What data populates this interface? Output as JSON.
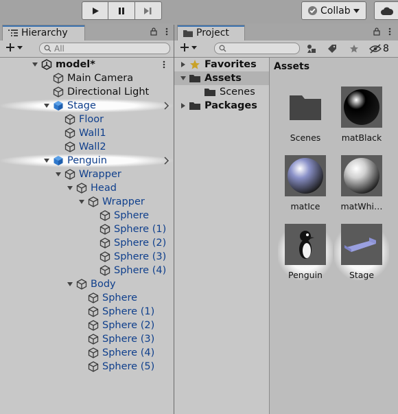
{
  "toolbar": {
    "collab_label": "Collab",
    "play_icon": "play-icon",
    "pause_icon": "pause-icon",
    "step_icon": "step-icon"
  },
  "hierarchy": {
    "tab_label": "Hierarchy",
    "search_placeholder": "All",
    "rows": [
      {
        "label": "model*",
        "depth": 0,
        "fold": "open",
        "icon": "unity-scene-icon",
        "blue": false,
        "bold": true,
        "menu": true
      },
      {
        "label": "Main Camera",
        "depth": 1,
        "fold": "",
        "icon": "gameobject-icon",
        "blue": false
      },
      {
        "label": "Directional Light",
        "depth": 1,
        "fold": "",
        "icon": "gameobject-icon",
        "blue": false
      },
      {
        "label": "Stage",
        "depth": 1,
        "fold": "open",
        "icon": "prefab-icon",
        "blue": true,
        "arrow": true,
        "highlight": true
      },
      {
        "label": "Floor",
        "depth": 2,
        "fold": "",
        "icon": "gameobject-icon",
        "blue": true
      },
      {
        "label": "Wall1",
        "depth": 2,
        "fold": "",
        "icon": "gameobject-icon",
        "blue": true
      },
      {
        "label": "Wall2",
        "depth": 2,
        "fold": "",
        "icon": "gameobject-icon",
        "blue": true
      },
      {
        "label": "Penguin",
        "depth": 1,
        "fold": "open",
        "icon": "prefab-icon",
        "blue": true,
        "arrow": true,
        "highlight": true
      },
      {
        "label": "Wrapper",
        "depth": 2,
        "fold": "open",
        "icon": "gameobject-icon",
        "blue": true
      },
      {
        "label": "Head",
        "depth": 3,
        "fold": "open",
        "icon": "gameobject-icon",
        "blue": true
      },
      {
        "label": "Wrapper",
        "depth": 4,
        "fold": "open",
        "icon": "gameobject-icon",
        "blue": true
      },
      {
        "label": "Sphere",
        "depth": 5,
        "fold": "",
        "icon": "gameobject-icon",
        "blue": true
      },
      {
        "label": "Sphere (1)",
        "depth": 5,
        "fold": "",
        "icon": "gameobject-icon",
        "blue": true
      },
      {
        "label": "Sphere (2)",
        "depth": 5,
        "fold": "",
        "icon": "gameobject-icon",
        "blue": true
      },
      {
        "label": "Sphere (3)",
        "depth": 5,
        "fold": "",
        "icon": "gameobject-icon",
        "blue": true
      },
      {
        "label": "Sphere (4)",
        "depth": 5,
        "fold": "",
        "icon": "gameobject-icon",
        "blue": true
      },
      {
        "label": "Body",
        "depth": 3,
        "fold": "open",
        "icon": "gameobject-icon",
        "blue": true
      },
      {
        "label": "Sphere",
        "depth": 4,
        "fold": "",
        "icon": "gameobject-icon",
        "blue": true
      },
      {
        "label": "Sphere (1)",
        "depth": 4,
        "fold": "",
        "icon": "gameobject-icon",
        "blue": true
      },
      {
        "label": "Sphere (2)",
        "depth": 4,
        "fold": "",
        "icon": "gameobject-icon",
        "blue": true
      },
      {
        "label": "Sphere (3)",
        "depth": 4,
        "fold": "",
        "icon": "gameobject-icon",
        "blue": true
      },
      {
        "label": "Sphere (4)",
        "depth": 4,
        "fold": "",
        "icon": "gameobject-icon",
        "blue": true
      },
      {
        "label": "Sphere (5)",
        "depth": 4,
        "fold": "",
        "icon": "gameobject-icon",
        "blue": true
      }
    ]
  },
  "project": {
    "tab_label": "Project",
    "hidden_count": "8",
    "tree": [
      {
        "label": "Favorites",
        "fold": "closed",
        "icon": "star-icon",
        "bold": true,
        "depth": 0
      },
      {
        "label": "Assets",
        "fold": "open",
        "icon": "folder-open-icon",
        "bold": true,
        "depth": 0,
        "selected": true
      },
      {
        "label": "Scenes",
        "fold": "",
        "icon": "folder-icon",
        "bold": false,
        "depth": 1
      },
      {
        "label": "Packages",
        "fold": "closed",
        "icon": "folder-icon",
        "bold": true,
        "depth": 0
      }
    ],
    "breadcrumb": "Assets",
    "assets": [
      {
        "label": "Scenes",
        "kind": "folder"
      },
      {
        "label": "matBlack",
        "kind": "material",
        "color": "#000000"
      },
      {
        "label": "matIce",
        "kind": "material",
        "color": "#8a91c8"
      },
      {
        "label": "matWhi…",
        "kind": "material",
        "color": "#d0d0d0"
      },
      {
        "label": "Penguin",
        "kind": "prefab-penguin"
      },
      {
        "label": "Stage",
        "kind": "prefab-stage"
      }
    ]
  }
}
